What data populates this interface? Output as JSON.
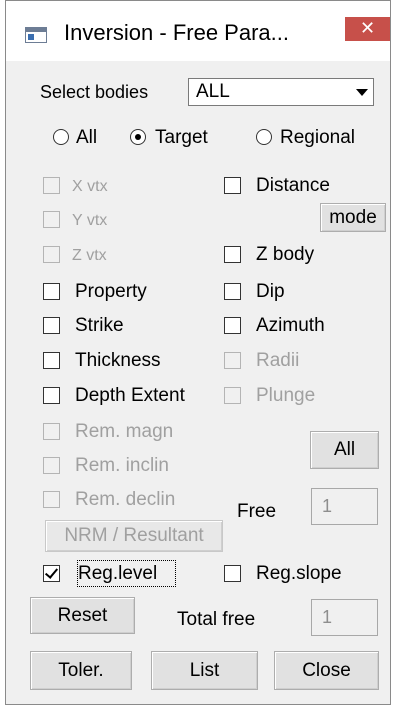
{
  "window": {
    "title": "Inversion - Free Para...",
    "close_symbol": "✕",
    "accent": "#c7504a"
  },
  "select_bodies": {
    "label": "Select bodies",
    "value": "ALL"
  },
  "mode_radios": [
    {
      "label": "All",
      "checked": false
    },
    {
      "label": "Target",
      "checked": true
    },
    {
      "label": "Regional",
      "checked": false
    }
  ],
  "left_params": [
    {
      "label": "X vtx",
      "checked": false,
      "enabled": false
    },
    {
      "label": "Y vtx",
      "checked": false,
      "enabled": false
    },
    {
      "label": "Z vtx",
      "checked": false,
      "enabled": false
    },
    {
      "label": "Property",
      "checked": false,
      "enabled": true
    },
    {
      "label": "Strike",
      "checked": false,
      "enabled": true
    },
    {
      "label": "Thickness",
      "checked": false,
      "enabled": true
    },
    {
      "label": "Depth Extent",
      "checked": false,
      "enabled": true
    },
    {
      "label": "Rem. magn",
      "checked": false,
      "enabled": false
    },
    {
      "label": "Rem. inclin",
      "checked": false,
      "enabled": false
    },
    {
      "label": "Rem. declin",
      "checked": false,
      "enabled": false
    }
  ],
  "right_params": [
    {
      "label": "Distance",
      "checked": false,
      "enabled": true
    },
    {
      "label": "Z body",
      "checked": false,
      "enabled": true
    },
    {
      "label": "Dip",
      "checked": false,
      "enabled": true
    },
    {
      "label": "Azimuth",
      "checked": false,
      "enabled": true
    },
    {
      "label": "Radii",
      "checked": false,
      "enabled": false
    },
    {
      "label": "Plunge",
      "checked": false,
      "enabled": false
    }
  ],
  "buttons": {
    "mode": "mode",
    "all": "All",
    "nrm": "NRM / Resultant",
    "reset": "Reset",
    "toler": "Toler.",
    "list": "List",
    "close": "Close"
  },
  "free": {
    "label": "Free",
    "value": "1"
  },
  "total_free": {
    "label": "Total free",
    "value": "1"
  },
  "reg_level": {
    "label": "Reg.level",
    "checked": true
  },
  "reg_slope": {
    "label": "Reg.slope",
    "checked": false
  }
}
